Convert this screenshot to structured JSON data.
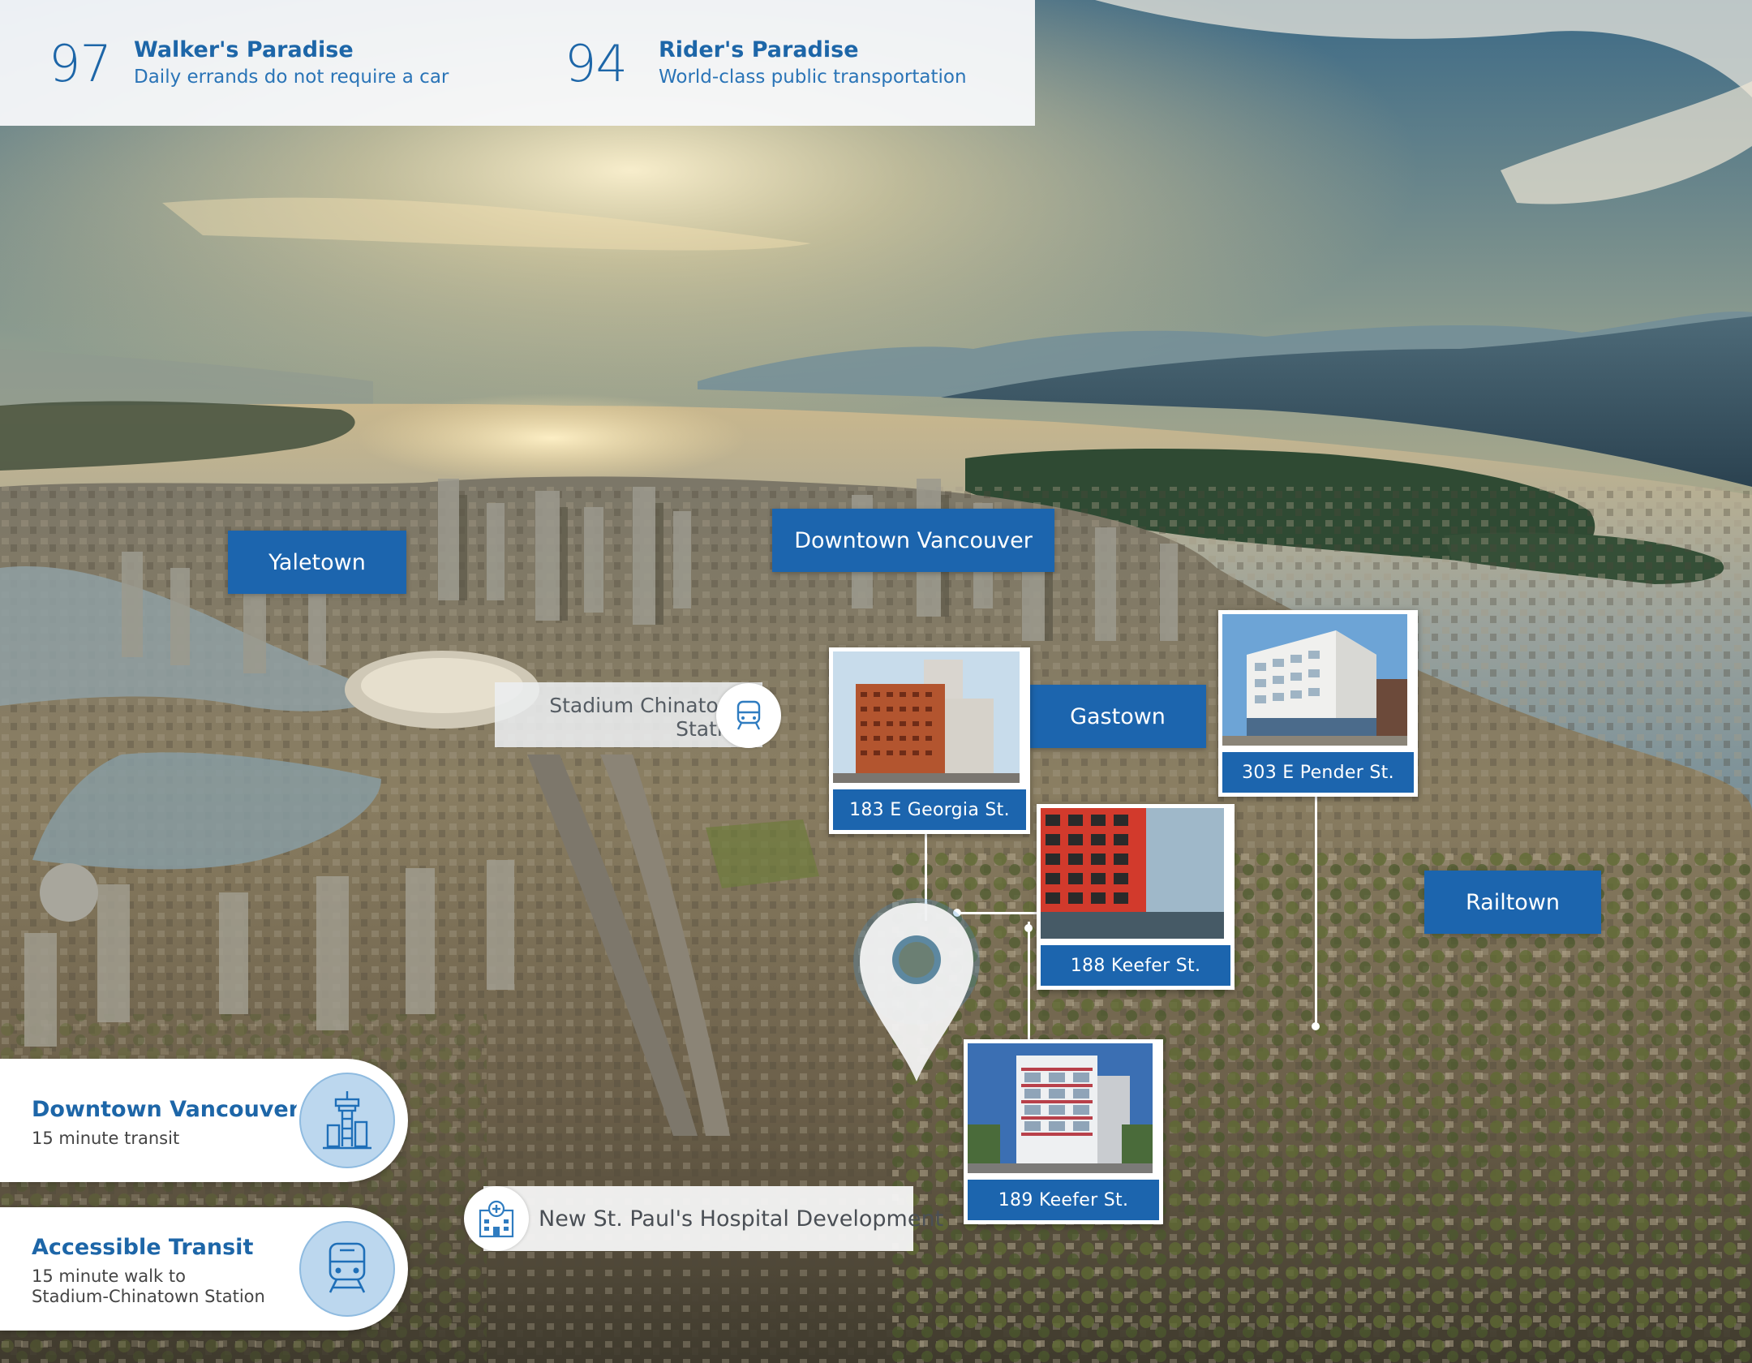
{
  "scores": [
    {
      "number": "97",
      "title": "Walker's Paradise",
      "subtitle": "Daily errands do not require a car"
    },
    {
      "number": "94",
      "title": "Rider's Paradise",
      "subtitle": "World-class public transportation"
    }
  ],
  "neighbourhoods": {
    "yaletown": "Yaletown",
    "downtown": "Downtown Vancouver",
    "gastown": "Gastown",
    "railtown": "Railtown"
  },
  "station_label": {
    "line1": "Stadium Chinatown",
    "line2": "Station",
    "icon": "train-icon"
  },
  "properties": [
    {
      "address": "183 E Georgia St."
    },
    {
      "address": "303 E Pender St."
    },
    {
      "address": "188 Keefer St."
    },
    {
      "address": "189 Keefer St."
    }
  ],
  "hospital": {
    "label": "New St. Paul's Hospital Development",
    "icon": "hospital-icon"
  },
  "info_cards": [
    {
      "title": "Downtown Vancouver",
      "subtitle": "15 minute transit",
      "icon": "tower-icon"
    },
    {
      "title": "Accessible Transit",
      "subtitle": "15 minute walk to Stadium-Chinatown Station",
      "icon": "train-icon"
    }
  ],
  "colors": {
    "brand_blue": "#1c65ae",
    "title_blue": "#1d66a8",
    "icon_fill": "#bcd7ee"
  }
}
